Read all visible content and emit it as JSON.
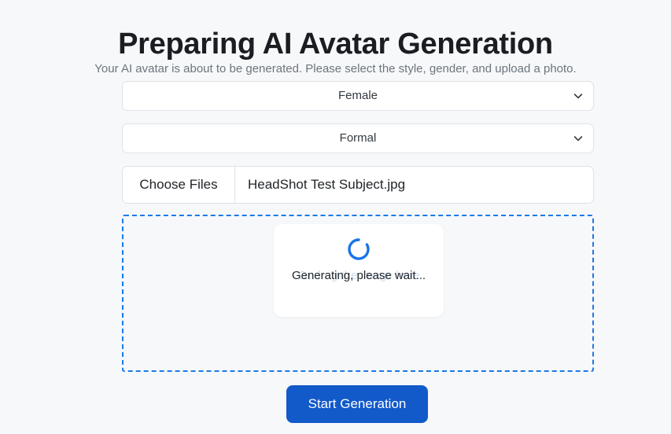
{
  "header": {
    "title": "Preparing AI Avatar Generation",
    "subtitle": "Your AI avatar is about to be generated. Please select the style, gender, and upload a photo."
  },
  "form": {
    "gender_select": {
      "name": "gender",
      "value": "Female",
      "icon": "chevron-down-icon"
    },
    "style_select": {
      "name": "style",
      "value": "Formal",
      "icon": "chevron-down-icon"
    },
    "file_input": {
      "button_label": "Choose Files",
      "file_name": "HeadShot Test Subject.jpg"
    }
  },
  "drop_zone": {
    "drag_hint": "Or drag the image here",
    "status_text": "Generating, please wait...",
    "spinner_icon": "loading-spinner-icon"
  },
  "actions": {
    "start_label": "Start Generation"
  },
  "colors": {
    "accent": "#1a7ae8",
    "button": "#1259ca",
    "page_background": "#f7f8fa",
    "title": "#1a1d21",
    "subtitle": "#6c757d",
    "drag_hint": "#ccdcf0"
  }
}
